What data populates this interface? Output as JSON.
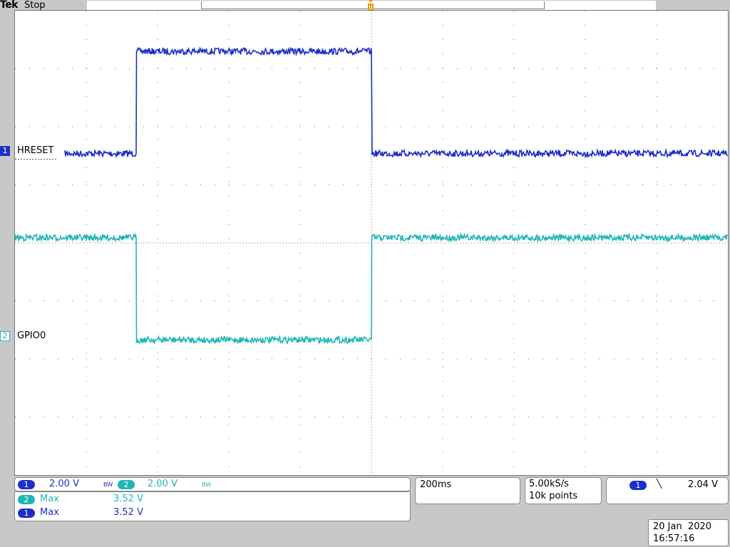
{
  "header": {
    "brand": "Tek",
    "state": "Stop",
    "trigger_position_marker": "trigger-position-icon"
  },
  "colors": {
    "ch1": "#1e2ec8",
    "ch2": "#20b5b5",
    "graticule": "#777777",
    "trigger": "#f29500"
  },
  "channels": [
    {
      "marker": "1",
      "label": "HRESET"
    },
    {
      "marker": "2",
      "label": "GPIO0"
    }
  ],
  "vertical": {
    "ch1_num": "1",
    "ch1_scale": "2.00 V",
    "ch1_bw": "BW",
    "ch2_num": "2",
    "ch2_scale": "2.00 V",
    "ch2_bw": "BW"
  },
  "measurements": [
    {
      "channel": "2",
      "name": "Max",
      "value": "3.52 V"
    },
    {
      "channel": "1",
      "name": "Max",
      "value": "3.52 V"
    }
  ],
  "timebase": {
    "scale": "200ms"
  },
  "acquisition": {
    "rate": "5.00kS/s",
    "record": "10k points"
  },
  "trigger": {
    "channel": "1",
    "slope_icon": "falling-edge-icon",
    "slope_glyph": "╲",
    "level": "2.04 V"
  },
  "datetime": {
    "date": "20 Jan  2020",
    "time": "16:57:16"
  },
  "chart_data": {
    "type": "line",
    "x_unit": "s",
    "y_unit": "V",
    "x_divisions": 10,
    "y_divisions": 8,
    "x_scale_per_div": 0.2,
    "y_scale_per_div": 2.0,
    "series": [
      {
        "name": "HRESET",
        "color": "#1e2ec8",
        "x": [
          -0.86,
          -0.66,
          -0.659,
          -0.0,
          0.0,
          0.002,
          1.0
        ],
        "y": [
          0.0,
          0.0,
          3.52,
          3.52,
          3.52,
          0.0,
          0.0
        ]
      },
      {
        "name": "GPIO0",
        "color": "#20b5b5",
        "x": [
          -1.0,
          -0.66,
          -0.659,
          0.0,
          0.001,
          1.0
        ],
        "y": [
          3.52,
          3.52,
          0.0,
          0.0,
          3.52,
          3.52
        ]
      }
    ]
  }
}
